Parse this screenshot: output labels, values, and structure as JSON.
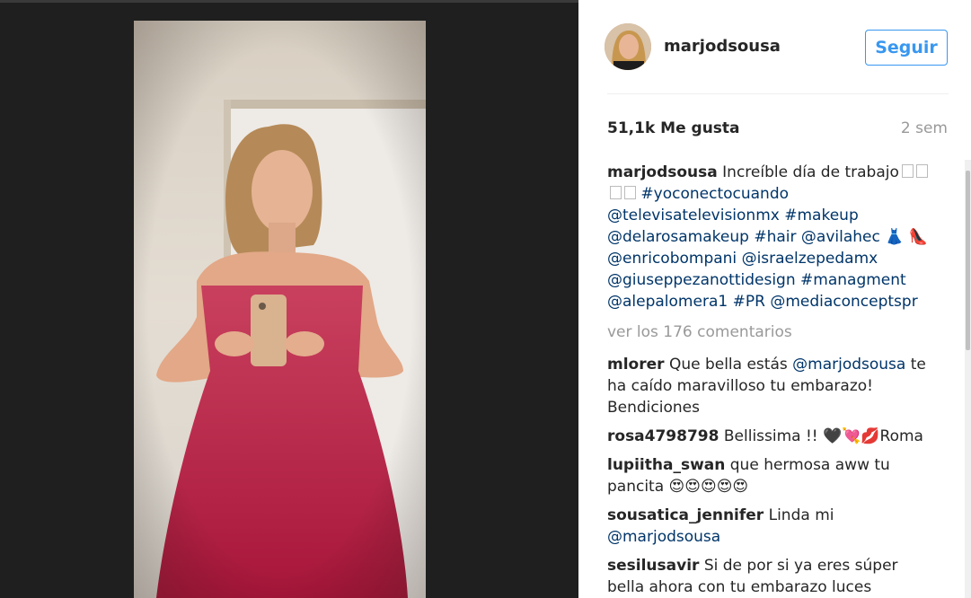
{
  "post": {
    "username": "marjodsousa",
    "follow_label": "Seguir",
    "likes": "51,1k Me gusta",
    "time": "2 sem",
    "caption": {
      "user": "marjodsousa",
      "text1": "Increíble día de trabajo",
      "tag1": "#yoconectocuando",
      "tag2": "@televisatelevisionmx",
      "tag3": "#makeup",
      "tag4": "@delarosamakeup",
      "tag5": "#hair",
      "tag6": "@avilahec",
      "tag7": "@enricobompani",
      "tag8": "@israelzepedamx",
      "tag9": "@giuseppezanottidesign",
      "tag10": "#managment",
      "tag11": "@alepalomera1",
      "tag12": "#PR",
      "tag13": "@mediaconceptspr"
    },
    "view_more": "ver los 176 comentarios",
    "comments": [
      {
        "user": "mlorer",
        "text": "Que bella estás",
        "mention": "@marjodsousa",
        "text2": "te ha caído maravilloso tu embarazo! Bendiciones"
      },
      {
        "user": "rosa4798798",
        "text": "Bellissima !! 🖤💘💋Roma"
      },
      {
        "user": "lupiitha_swan",
        "text": "que hermosa aww tu pancita 😍😍😍😍😍"
      },
      {
        "user": "sousatica_jennifer",
        "text": "Linda mi",
        "mention": "@marjodsousa"
      },
      {
        "user": "sesilusavir",
        "text": "Si de por si ya eres súper bella ahora con tu embarazo luces"
      }
    ]
  }
}
